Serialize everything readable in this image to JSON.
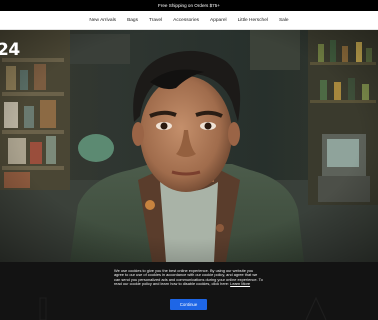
{
  "promo": {
    "text": "Free Shipping on Orders $75+"
  },
  "nav": {
    "items": [
      {
        "label": "New Arrivals"
      },
      {
        "label": "Bags"
      },
      {
        "label": "Travel"
      },
      {
        "label": "Accessories"
      },
      {
        "label": "Apparel"
      },
      {
        "label": "Little Herschel"
      },
      {
        "label": "Sale"
      }
    ]
  },
  "hero": {
    "year_text": "24"
  },
  "cookie": {
    "message": "We use cookies to give you the best online experience. By using our website you agree to our use of cookies in accordance with our cookie policy, and agree that we can send you personalized ads and communications during your online experience. To read our cookie policy and learn how to disable cookies, click here:",
    "link_label": "Learn More",
    "button_label": "Continue"
  },
  "colors": {
    "continue_button": "#1e66e6",
    "banner_background": "#141414"
  }
}
